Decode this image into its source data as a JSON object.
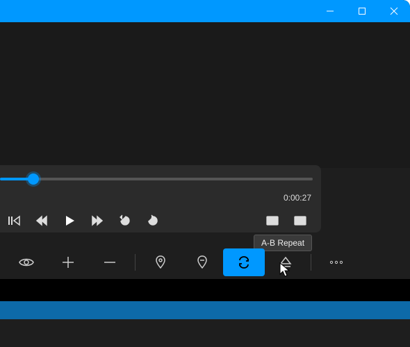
{
  "window": {
    "accent_color": "#0098ff"
  },
  "player": {
    "time_total": "0:00:27",
    "seek_percent": 10,
    "controls": {
      "skip_back_label": "Skip back",
      "rewind_label": "Rewind",
      "play_label": "Play",
      "forward_label": "Fast forward",
      "back30_label": "Back 30s",
      "replay_label": "Replay",
      "pip_label": "Picture in picture",
      "fullscreen_label": "Full screen"
    }
  },
  "toolbar": {
    "visibility_label": "Visibility",
    "add_label": "Add",
    "remove_label": "Remove",
    "marker_in_label": "Set marker",
    "marker_out_label": "Clear marker",
    "ab_repeat_label": "A-B Repeat",
    "eject_label": "Eject",
    "more_label": "More"
  },
  "tooltip": {
    "text": "A-B Repeat"
  }
}
